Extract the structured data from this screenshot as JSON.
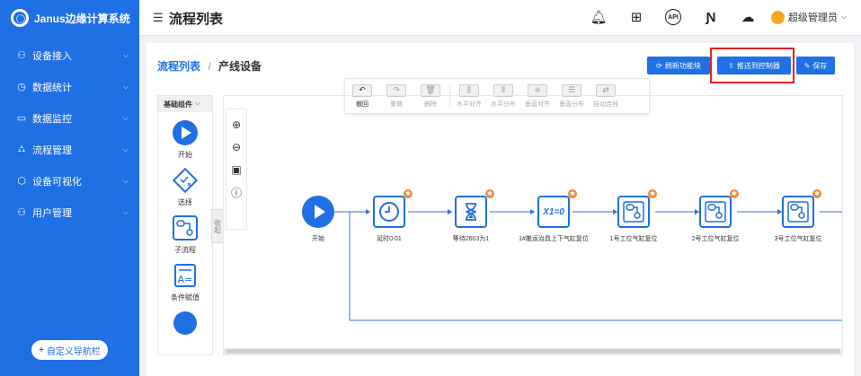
{
  "app": {
    "name": "Janus边缘计算系统"
  },
  "sidebar": {
    "items": [
      {
        "label": "设备接入",
        "icon": "device-icon",
        "glyph": "⚇"
      },
      {
        "label": "数据统计",
        "icon": "clock-icon",
        "glyph": "◷"
      },
      {
        "label": "数据监控",
        "icon": "monitor-icon",
        "glyph": "▭"
      },
      {
        "label": "流程管理",
        "icon": "flow-icon",
        "glyph": "⛼"
      },
      {
        "label": "设备可视化",
        "icon": "cube-icon",
        "glyph": "⬡"
      },
      {
        "label": "用户管理",
        "icon": "users-icon",
        "glyph": "⚇"
      }
    ],
    "custom_nav_label": "自定义导航栏"
  },
  "header": {
    "title": "流程列表",
    "user_name": "超级管理员",
    "icons": [
      "bell-icon",
      "apps-icon",
      "api-icon",
      "n-icon",
      "cloud-icon"
    ],
    "api_text": "API"
  },
  "breadcrumb": {
    "parent": "流程列表",
    "separator": "/",
    "current": "产线设备"
  },
  "actions": {
    "refresh": "刷新功能块",
    "push": "推送到控制器",
    "save": "保存"
  },
  "toolbar": [
    {
      "label": "撤回",
      "icon": "undo-icon",
      "glyph": "↶",
      "active": true
    },
    {
      "label": "重做",
      "icon": "redo-icon",
      "glyph": "↷",
      "active": false
    },
    {
      "label": "删除",
      "icon": "delete-icon",
      "glyph": "🗑",
      "active": false
    },
    {
      "label": "水平对齐",
      "icon": "align-horizontal-icon",
      "glyph": "⫼",
      "active": false
    },
    {
      "label": "水平分布",
      "icon": "distribute-horizontal-icon",
      "glyph": "⫴",
      "active": false
    },
    {
      "label": "垂直对齐",
      "icon": "align-vertical-icon",
      "glyph": "≑",
      "active": false
    },
    {
      "label": "垂直分布",
      "icon": "distribute-vertical-icon",
      "glyph": "☰",
      "active": false
    },
    {
      "label": "自动连线",
      "icon": "auto-connect-icon",
      "glyph": "⇄",
      "active": false
    }
  ],
  "palette": {
    "title": "基础组件",
    "items": [
      "开始",
      "选择",
      "子流程",
      "条件赋值"
    ],
    "collapse_label": "收起"
  },
  "flow": {
    "start_label": "开始",
    "nodes": [
      {
        "label": "延时0.01",
        "icon": "timer-icon"
      },
      {
        "label": "等待2603为1",
        "icon": "hourglass-icon"
      },
      {
        "label": "1#搬运治具上下气缸复位",
        "icon": "assign-icon",
        "text": "X1=0"
      },
      {
        "label": "1号工位气缸复位",
        "icon": "subflow-icon"
      },
      {
        "label": "2号工位气缸复位",
        "icon": "subflow-icon"
      },
      {
        "label": "3号工位气缸复位",
        "icon": "subflow-icon"
      }
    ]
  }
}
